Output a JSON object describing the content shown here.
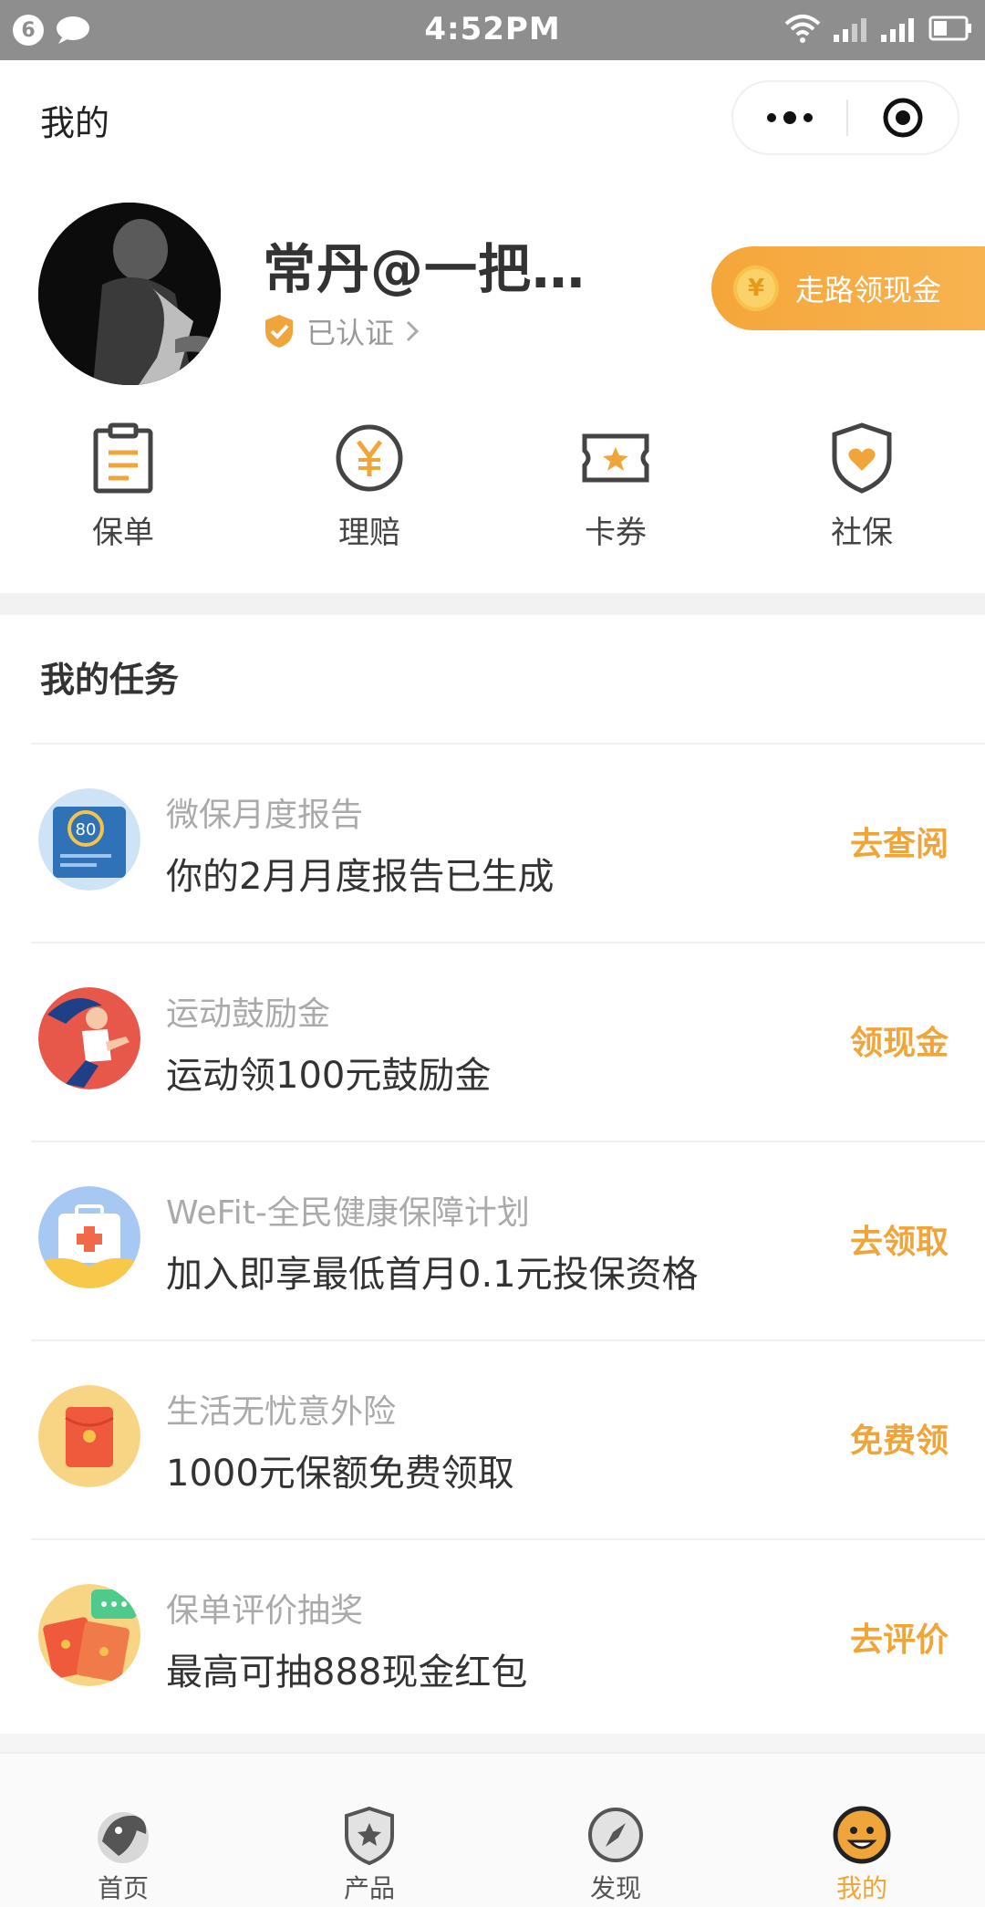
{
  "status_bar": {
    "notification_count": "6",
    "time": "4:52PM"
  },
  "header": {
    "title": "我的"
  },
  "profile": {
    "name": "常丹@一把…",
    "verified_label": "已认证",
    "walk_cash_label": "走路领现金",
    "coin_symbol": "¥"
  },
  "quick_actions": [
    {
      "label": "保单",
      "icon": "clipboard-icon"
    },
    {
      "label": "理赔",
      "icon": "yuan-coin-icon"
    },
    {
      "label": "卡券",
      "icon": "ticket-star-icon"
    },
    {
      "label": "社保",
      "icon": "shield-heart-icon"
    }
  ],
  "tasks": {
    "title": "我的任务",
    "items": [
      {
        "subtitle": "微保月度报告",
        "main": "你的2月月度报告已生成",
        "action": "去查阅",
        "icon": "report-80-icon",
        "badge": "80"
      },
      {
        "subtitle": "运动鼓励金",
        "main": "运动领100元鼓励金",
        "action": "领现金",
        "icon": "runner-icon"
      },
      {
        "subtitle": "WeFit-全民健康保障计划",
        "main": "加入即享最低首月0.1元投保资格",
        "action": "去领取",
        "icon": "medical-kit-icon"
      },
      {
        "subtitle": "生活无忧意外险",
        "main": "1000元保额免费领取",
        "action": "免费领",
        "icon": "red-envelope-icon"
      },
      {
        "subtitle": "保单评价抽奖",
        "main": "最高可抽888现金红包",
        "action": "去评价",
        "icon": "chat-envelope-icon"
      }
    ]
  },
  "tab_bar": [
    {
      "label": "首页",
      "icon": "home-icon",
      "active": false
    },
    {
      "label": "产品",
      "icon": "shield-star-icon",
      "active": false
    },
    {
      "label": "发现",
      "icon": "compass-icon",
      "active": false
    },
    {
      "label": "我的",
      "icon": "smiley-icon",
      "active": true
    }
  ],
  "colors": {
    "accent": "#f0a53a",
    "status_bar": "#8e8e8e"
  }
}
